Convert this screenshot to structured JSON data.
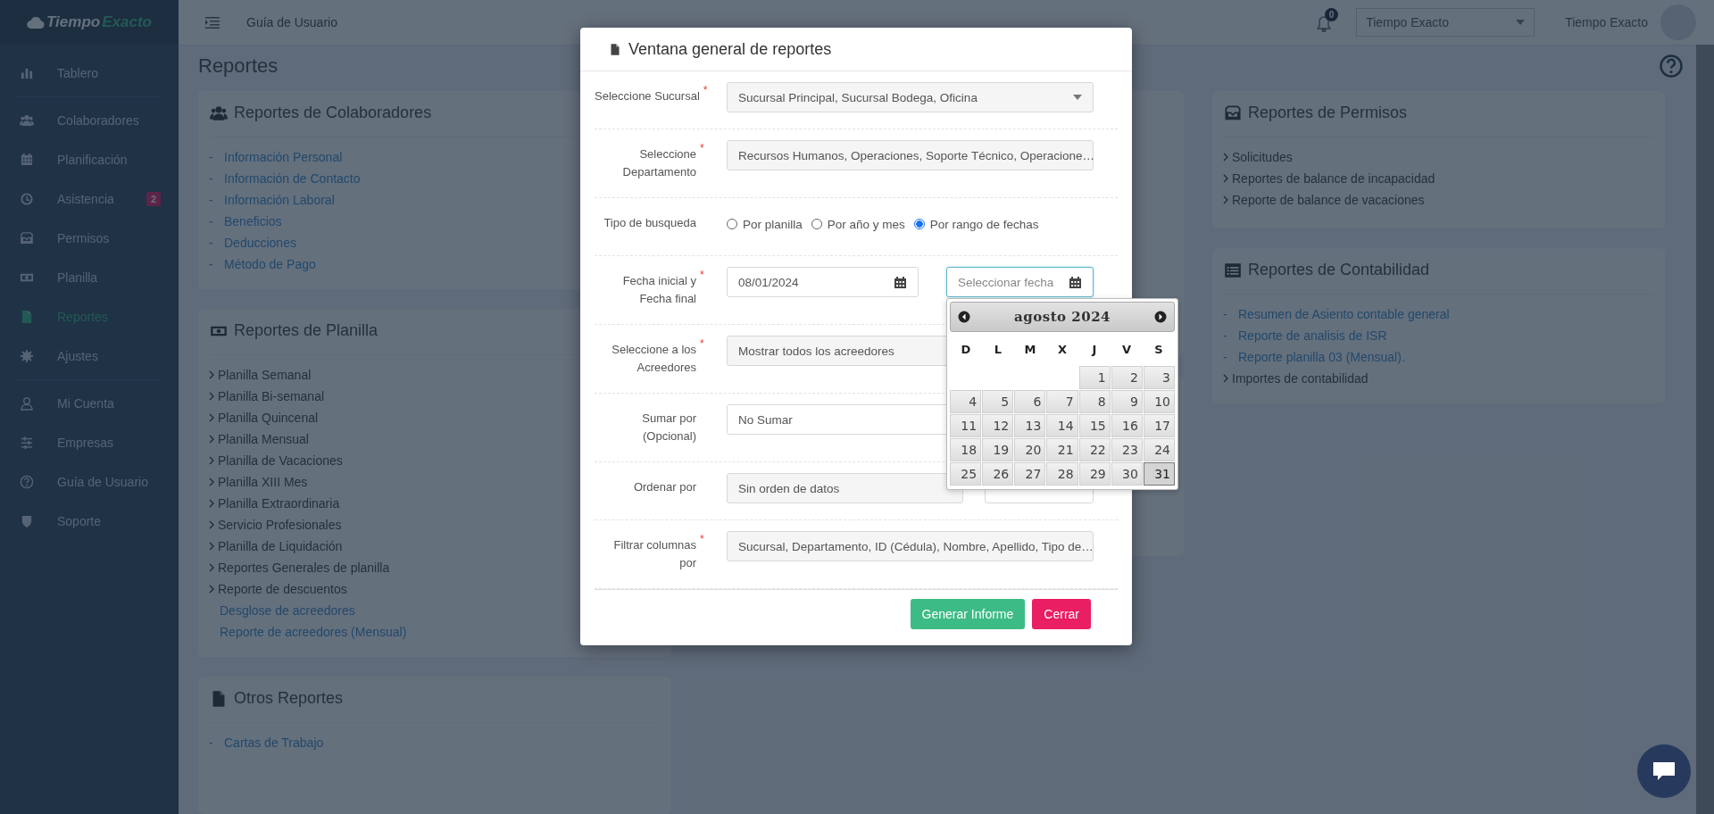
{
  "brand": {
    "first": "Tiempo",
    "second": "Exacto"
  },
  "sidebar": {
    "items": [
      {
        "label": "Tablero",
        "selected": false,
        "divider_after": true
      },
      {
        "label": "Colaboradores",
        "selected": false,
        "divider_after": false
      },
      {
        "label": "Planificación",
        "selected": false,
        "divider_after": false
      },
      {
        "label": "Asistencia",
        "selected": false,
        "divider_after": false,
        "badge": "2"
      },
      {
        "label": "Permisos",
        "selected": false,
        "divider_after": false
      },
      {
        "label": "Planilla",
        "selected": false,
        "divider_after": false
      },
      {
        "label": "Reportes",
        "selected": true,
        "divider_after": false
      },
      {
        "label": "Ajustes",
        "selected": false,
        "divider_after": true
      },
      {
        "label": "Mi Cuenta",
        "selected": false,
        "divider_after": false
      },
      {
        "label": "Empresas",
        "selected": false,
        "divider_after": false
      },
      {
        "label": "Guía de Usuario",
        "selected": false,
        "divider_after": false
      },
      {
        "label": "Soporte",
        "selected": false,
        "divider_after": false
      }
    ]
  },
  "topbar": {
    "link": "Guía de Usuario",
    "notification_count": "0",
    "company_select": "Tiempo Exacto",
    "user_name": "Tiempo Exacto"
  },
  "page_title": "Reportes",
  "columns": [
    [
      {
        "title": "Reportes de Colaboradores",
        "items": [
          {
            "kind": "dash-link",
            "marker": "-",
            "label": "Información Personal"
          },
          {
            "kind": "dash-link",
            "marker": "-",
            "label": "Información de Contacto"
          },
          {
            "kind": "dash-link",
            "marker": "-",
            "label": "Información Laboral"
          },
          {
            "kind": "dash-link",
            "marker": "-",
            "label": "Beneficios"
          },
          {
            "kind": "dash-link",
            "marker": "-",
            "label": "Deducciones"
          },
          {
            "kind": "dash-link",
            "marker": "-",
            "label": "Método de Pago"
          }
        ]
      },
      {
        "title": "Reportes de Planilla",
        "items": [
          {
            "kind": "chevron",
            "label": "Planilla Semanal"
          },
          {
            "kind": "chevron",
            "label": "Planilla Bi-semanal"
          },
          {
            "kind": "chevron",
            "label": "Planilla Quincenal"
          },
          {
            "kind": "chevron",
            "label": "Planilla Mensual"
          },
          {
            "kind": "chevron",
            "label": "Planilla de Vacaciones"
          },
          {
            "kind": "chevron",
            "label": "Planilla XIII Mes"
          },
          {
            "kind": "chevron",
            "label": "Planilla Extraordinaria"
          },
          {
            "kind": "chevron",
            "label": "Servicio Profesionales"
          },
          {
            "kind": "chevron",
            "label": "Planilla de Liquidación"
          },
          {
            "kind": "chevron",
            "label": "Reportes Generales de planilla"
          },
          {
            "kind": "chevron",
            "label": "Reporte de descuentos"
          },
          {
            "kind": "link",
            "label": "Desglose de acreedores"
          },
          {
            "kind": "link",
            "label": "Reporte de acreedores (Mensual)"
          }
        ]
      },
      {
        "title": "Otros Reportes",
        "items": [
          {
            "kind": "dash-link",
            "marker": "-",
            "label": "Cartas de Trabajo"
          }
        ]
      }
    ],
    [],
    [
      {
        "title": "Reportes de Permisos",
        "items": [
          {
            "kind": "chevron",
            "label": "Solicitudes"
          },
          {
            "kind": "chevron",
            "label": "Reportes de balance de incapacidad"
          },
          {
            "kind": "chevron",
            "label": "Reporte de balance de vacaciones"
          }
        ]
      },
      {
        "title": "Reportes de Contabilidad",
        "items": [
          {
            "kind": "dash-link",
            "marker": "-",
            "label": "Resumen de Asiento contable general"
          },
          {
            "kind": "dash-link",
            "marker": "-",
            "label": "Reporte de analisis de ISR"
          },
          {
            "kind": "dash-link",
            "marker": "-",
            "label": "Reporte planilla 03 (Mensual)."
          },
          {
            "kind": "chevron",
            "label": "Importes de contabilidad"
          }
        ]
      }
    ]
  ],
  "modal": {
    "title": "Ventana general de reportes",
    "rows": [
      {
        "kind": "select",
        "label": "Seleccione Sucursal",
        "required": "*",
        "value": "Sucursal Principal, Sucursal Bodega, Oficina"
      },
      {
        "kind": "select",
        "label": "Seleccione\nDepartamento",
        "required": "*",
        "value": "Recursos Humanos, Operaciones, Soporte Técnico, Operacione…"
      },
      {
        "kind": "radio",
        "label": "Tipo de busqueda",
        "options": [
          {
            "label": "Por planilla",
            "selected": false
          },
          {
            "label": "Por año y mes",
            "selected": false
          },
          {
            "label": "Por rango de fechas",
            "selected": true
          }
        ]
      },
      {
        "kind": "daterange",
        "label": "Fecha inicial y\nFecha final",
        "required": "*",
        "start": {
          "value": "08/01/2024"
        },
        "end": {
          "placeholder": "Seleccionar fecha",
          "focused": true
        }
      },
      {
        "kind": "select",
        "label": "Seleccione a los\nAcreedores",
        "required": "*",
        "value": "Mostrar todos los acreedores"
      },
      {
        "kind": "input",
        "label": "Sumar por\n(Opcional)",
        "value": "No Sumar"
      },
      {
        "kind": "select-pair",
        "label": "Ordenar por",
        "value": "Sin orden de datos"
      },
      {
        "kind": "select",
        "label": "Filtrar columnas\npor",
        "required": "*",
        "value": "Sucursal, Departamento, ID (Cédula), Nombre, Apellido, Tipo de…"
      }
    ],
    "buttons": [
      {
        "label": "Generar Informe",
        "kind": "primary"
      },
      {
        "label": "Cerrar",
        "kind": "danger"
      }
    ]
  },
  "datepicker": {
    "month": "agosto 2024",
    "weekdays": [
      "D",
      "L",
      "M",
      "X",
      "J",
      "V",
      "S"
    ],
    "weeks": [
      [
        {
          "day": "1",
          "selected": false
        },
        {
          "day": "2",
          "selected": false
        },
        {
          "day": "3",
          "selected": false
        }
      ],
      [
        {
          "day": "4",
          "selected": false
        },
        {
          "day": "5",
          "selected": false
        },
        {
          "day": "6",
          "selected": false
        },
        {
          "day": "7",
          "selected": false
        },
        {
          "day": "8",
          "selected": false
        },
        {
          "day": "9",
          "selected": false
        },
        {
          "day": "10",
          "selected": false
        }
      ],
      [
        {
          "day": "11",
          "selected": false
        },
        {
          "day": "12",
          "selected": false
        },
        {
          "day": "13",
          "selected": false
        },
        {
          "day": "14",
          "selected": false
        },
        {
          "day": "15",
          "selected": false
        },
        {
          "day": "16",
          "selected": false
        },
        {
          "day": "17",
          "selected": false
        }
      ],
      [
        {
          "day": "18",
          "selected": false
        },
        {
          "day": "19",
          "selected": false
        },
        {
          "day": "20",
          "selected": false
        },
        {
          "day": "21",
          "selected": false
        },
        {
          "day": "22",
          "selected": false
        },
        {
          "day": "23",
          "selected": false
        },
        {
          "day": "24",
          "selected": false
        }
      ],
      [
        {
          "day": "25",
          "selected": false
        },
        {
          "day": "26",
          "selected": false
        },
        {
          "day": "27",
          "selected": false
        },
        {
          "day": "28",
          "selected": false
        },
        {
          "day": "29",
          "selected": false
        },
        {
          "day": "30",
          "selected": false
        },
        {
          "day": "31",
          "selected": true
        }
      ]
    ]
  }
}
